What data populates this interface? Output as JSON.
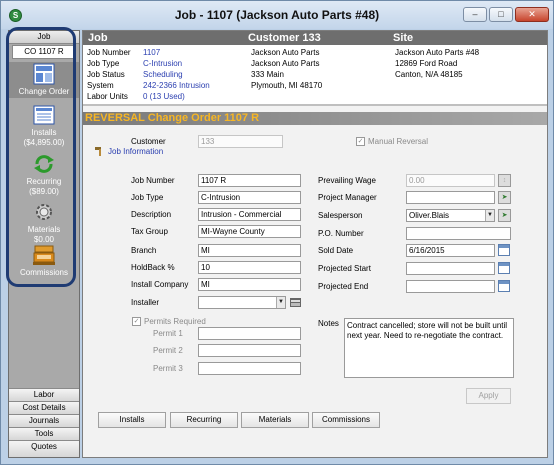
{
  "window": {
    "title": "Job - 1107 (Jackson Auto Parts #48)",
    "app_icon": "S"
  },
  "sidebar": {
    "header": "Job",
    "co": "CO 1107 R",
    "items": [
      {
        "label": "Change Order"
      },
      {
        "label": "Installs",
        "amount": "($4,895.00)"
      },
      {
        "label": "Recurring",
        "amount": "($89.00)"
      },
      {
        "label": "Materials",
        "amount": "$0.00"
      },
      {
        "label": "Commissions"
      }
    ],
    "bottom": [
      "Labor",
      "Cost Details",
      "Journals",
      "Tools",
      "Quotes"
    ]
  },
  "header": {
    "col_job": "Job",
    "col_customer": "Customer 133",
    "col_site": "Site",
    "job_number_label": "Job Number",
    "job_number": "1107",
    "job_type_label": "Job Type",
    "job_type": "C-Intrusion",
    "job_status_label": "Job Status",
    "job_status": "Scheduling",
    "system_label": "System",
    "system": "242-2366 Intrusion",
    "labor_units_label": "Labor Units",
    "labor_units": "0 (13 Used)",
    "customer_name": "Jackson Auto Parts",
    "customer_name2": "Jackson Auto Parts",
    "customer_addr": "333 Main",
    "customer_city": "Plymouth, MI 48170",
    "site_name": "Jackson Auto Parts #48",
    "site_addr": "12869 Ford Road",
    "site_city": "Canton, N/A  48185"
  },
  "reversal_title": "REVERSAL Change Order 1107 R",
  "form": {
    "customer_label": "Customer",
    "customer_value": "133",
    "manual_reversal_label": "Manual Reversal",
    "job_info_label": "Job Information",
    "job_number_label": "Job Number",
    "job_number": "1107 R",
    "job_type_label": "Job Type",
    "job_type": "C-Intrusion",
    "description_label": "Description",
    "description": "Intrusion - Commercial",
    "tax_group_label": "Tax Group",
    "tax_group": "MI-Wayne County",
    "branch_label": "Branch",
    "branch": "MI",
    "holdback_label": "HoldBack  %",
    "holdback": "10",
    "install_company_label": "Install Company",
    "install_company": "MI",
    "installer_label": "Installer",
    "installer": "",
    "permits_required_label": "Permits Required",
    "permit1_label": "Permit 1",
    "permit2_label": "Permit 2",
    "permit3_label": "Permit 3",
    "prevailing_wage_label": "Prevailing Wage",
    "prevailing_wage": "0.00",
    "project_manager_label": "Project Manager",
    "salesperson_label": "Salesperson",
    "salesperson": "Oliver.Blais",
    "po_number_label": "P.O. Number",
    "sold_date_label": "Sold Date",
    "sold_date": "6/16/2015",
    "projected_start_label": "Projected Start",
    "projected_end_label": "Projected End",
    "notes_label": "Notes",
    "notes": "Contract cancelled; store will not be built until next year.  Need to re-negotiate the contract."
  },
  "buttons": {
    "apply": "Apply",
    "installs": "Installs",
    "recurring": "Recurring",
    "materials": "Materials",
    "commissions": "Commissions"
  }
}
